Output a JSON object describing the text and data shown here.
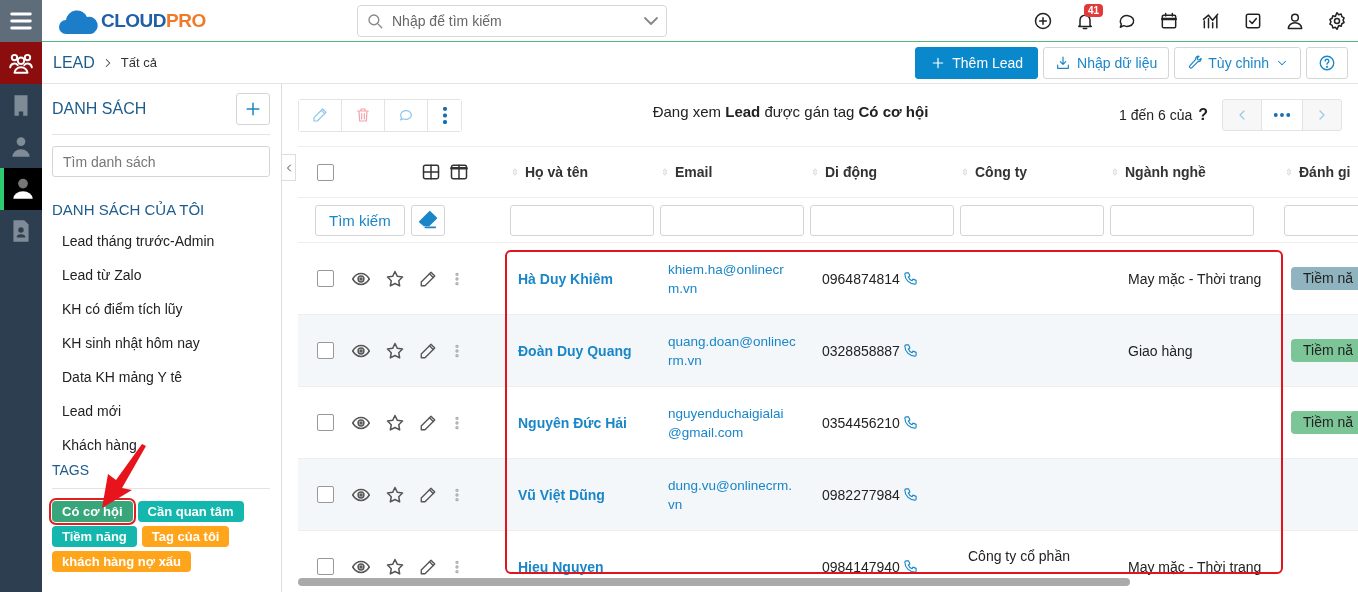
{
  "logo": {
    "first": "CLOUD",
    "second": "PRO"
  },
  "search": {
    "placeholder": "Nhập để tìm kiếm"
  },
  "header_icons": [
    {
      "kind": "add"
    },
    {
      "kind": "bell",
      "badge": "41"
    },
    {
      "kind": "chat"
    },
    {
      "kind": "calendar"
    },
    {
      "kind": "chart"
    },
    {
      "kind": "task"
    },
    {
      "kind": "user"
    },
    {
      "kind": "settings"
    }
  ],
  "rail": [
    {
      "kind": "menu",
      "selected": false
    },
    {
      "kind": "people",
      "selected": false,
      "color": "#8b0d0d"
    },
    {
      "kind": "building",
      "selected": false
    },
    {
      "kind": "contact",
      "selected": false
    },
    {
      "kind": "person",
      "selected": true
    },
    {
      "kind": "document",
      "selected": false
    }
  ],
  "breadcrumb": [
    "LEAD",
    "Tất cả"
  ],
  "actions": [
    {
      "kind": "primary",
      "label": "Thêm Lead"
    },
    {
      "kind": "import",
      "label": "Nhập dữ liệu"
    },
    {
      "kind": "customize",
      "label": "Tùy chỉnh"
    },
    {
      "kind": "help"
    }
  ],
  "sidebar": {
    "title": "DANH SÁCH",
    "search_placeholder": "Tìm danh sách",
    "section": "DANH SÁCH CỦA TÔI",
    "items": [
      "Lead tháng trước-Admin",
      "Lead từ Zalo",
      "KH có điểm tích lũy",
      "KH sinh nhật hôm nay",
      "Data KH mảng Y tê",
      "Lead mới",
      "Khách hàng"
    ],
    "tags_title": "TAGS",
    "tags": [
      {
        "label": "Có cơ hội",
        "color": "#38a67a",
        "selected": true
      },
      {
        "label": "Cần quan tâm",
        "color": "#14b7ae",
        "selected": false
      },
      {
        "label": "Tiềm năng",
        "color": "#14b7ae",
        "selected": false
      },
      {
        "label": "Tag của tôi",
        "color": "#ffa51c",
        "selected": false
      },
      {
        "label": "khách hàng nợ xấu",
        "color": "#ffa51c",
        "selected": false
      }
    ]
  },
  "toolbar": {
    "filter_text": "Đang xem **Lead** được gán tag **Có cơ hội**",
    "paging": "1 đến 6 của",
    "paging_help": "?"
  },
  "table": {
    "select_all_checked": false,
    "columns": [
      "Họ và tên",
      "Email",
      "Di động",
      "Công ty",
      "Ngành nghề",
      "Đánh gi"
    ],
    "search_button": "Tìm kiếm",
    "rows": [
      {
        "checked": false,
        "name": "Hà Duy Khiêm",
        "email": "khiem.ha@onlinecrm.vn",
        "phone": "0964874814",
        "company": "",
        "industry": "May mặc - Thời trang",
        "rating": {
          "label": "Tiềm nă",
          "color": "#8fb3bf"
        }
      },
      {
        "checked": false,
        "name": "Đoàn Duy Quang",
        "email": "quang.doan@onlinecrm.vn",
        "phone": "0328858887",
        "company": "",
        "industry": "Giao hàng",
        "rating": {
          "label": "Tiềm nă",
          "color": "#7cc597"
        }
      },
      {
        "checked": false,
        "name": "Nguyên Đức Hải",
        "email": "nguyenduchaigialai@gmail.com",
        "phone": "0354456210",
        "company": "",
        "industry": "",
        "rating": {
          "label": "Tiềm nă",
          "color": "#7cc597"
        }
      },
      {
        "checked": false,
        "name": "Vũ Việt Dũng",
        "email": "dung.vu@onlinecrm.vn",
        "phone": "0982277984",
        "company": "",
        "industry": ""
      },
      {
        "checked": false,
        "name": "Hieu Nguyen",
        "email": "",
        "phone": "0984147940",
        "company": "Công ty cổ phần",
        "industry": "May mặc - Thời trang"
      }
    ]
  }
}
